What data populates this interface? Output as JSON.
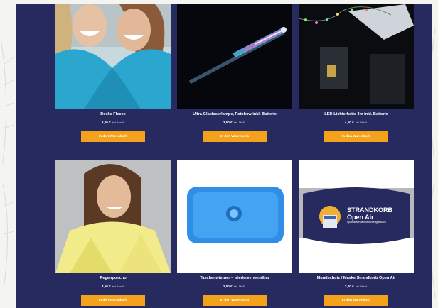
{
  "products": [
    {
      "name": "Decke Fleece",
      "price": "6,00 €",
      "tax": "inkl. MwSt.",
      "button": "In den Warenkorb"
    },
    {
      "name": "Ultra-Glasfaserlampe, Rainbow inkl. Batterie",
      "price": "3,50 €",
      "tax": "inkl. MwSt.",
      "button": "In den Warenkorb"
    },
    {
      "name": "LED-Lichterkette 3m inkl. Batterie",
      "price": "4,50 €",
      "tax": "inkl. MwSt.",
      "button": "In den Warenkorb"
    },
    {
      "name": "Regenponcho",
      "price": "3,50 €",
      "tax": "inkl. MwSt.",
      "button": "In den Warenkorb"
    },
    {
      "name": "Taschenwärmer – wiederverwendbar",
      "price": "2,50 €",
      "tax": "inkl. MwSt.",
      "button": "In den Warenkorb"
    },
    {
      "name": "Mundschutz / Maske Strandkorb Open Air",
      "price": "3,00 €",
      "tax": "inkl. MwSt.",
      "button": "In den Warenkorb"
    }
  ],
  "mask_logo": {
    "line1": "STRANDKORB",
    "line2": "Open Air",
    "subline": "Sparkassenpark Mönchengladbach"
  },
  "colors": {
    "panel": "#262a5e",
    "button": "#f4a21c"
  }
}
